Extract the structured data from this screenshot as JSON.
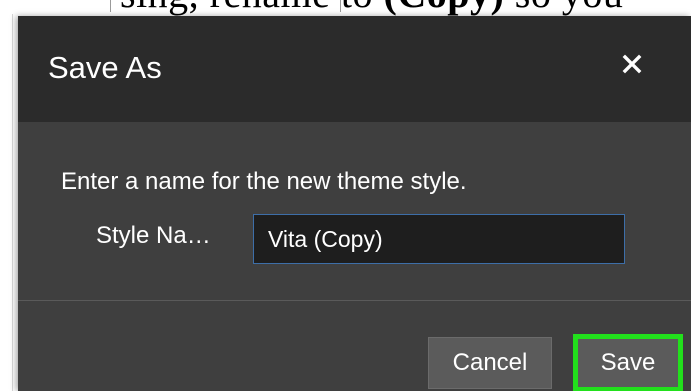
{
  "background": {
    "partial_text_prefix": "sing, rename to ",
    "partial_text_bold": "(Copy)",
    "partial_text_suffix": " so you"
  },
  "dialog": {
    "title": "Save As",
    "close_icon": "close-icon",
    "instruction": "Enter a name for the new theme style.",
    "style_name_label": "Style Na…",
    "style_name_value": "Vita (Copy)",
    "cancel_label": "Cancel",
    "save_label": "Save"
  },
  "colors": {
    "titlebar": "#2b2b2b",
    "body": "#3f3f3f",
    "input_border": "#3d6ea8",
    "highlight": "#22e01c"
  }
}
